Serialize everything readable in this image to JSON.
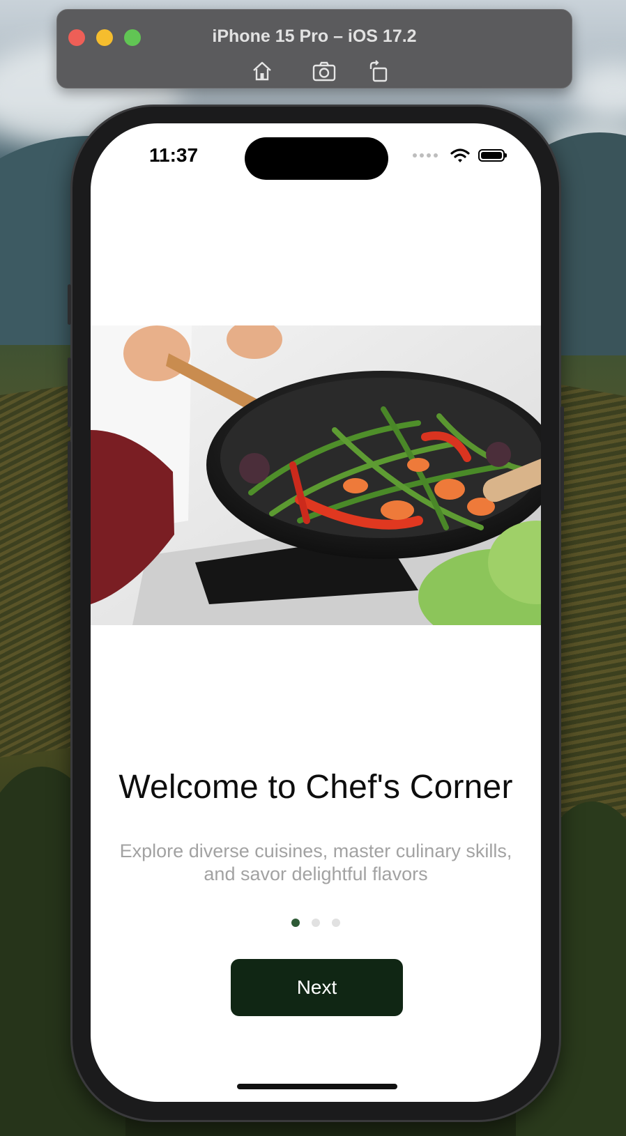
{
  "simulator": {
    "title": "iPhone 15 Pro – iOS 17.2",
    "toolbar": [
      "home-icon",
      "screenshot-icon",
      "rotate-icon"
    ]
  },
  "status_bar": {
    "time": "11:37",
    "icons": [
      "cellular-signal-icon",
      "wifi-icon",
      "battery-icon"
    ]
  },
  "onboarding": {
    "image": "chef stir-frying vegetables in wok",
    "title": "Welcome to Chef's Corner",
    "subtitle": "Explore diverse cuisines, master culinary skills, and savor delightful flavors",
    "page_count": 3,
    "current_page": 1,
    "next_label": "Next"
  },
  "colors": {
    "primary": "#102614",
    "active_dot": "#2e5a36",
    "inactive_dot": "#e1e1e1",
    "subtitle": "#a2a2a2"
  }
}
